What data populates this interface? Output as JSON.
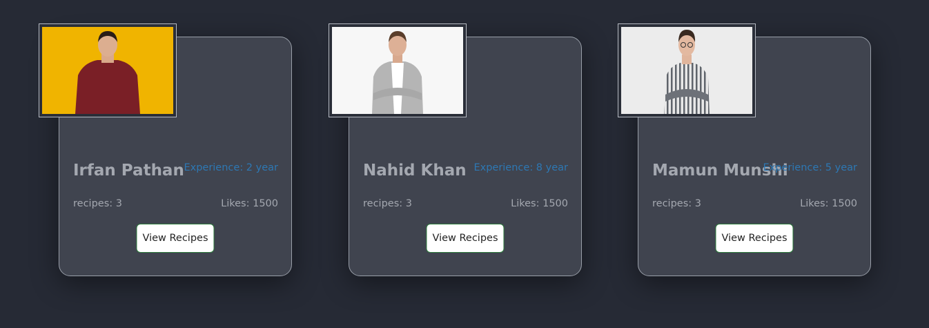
{
  "chefs": [
    {
      "name": "Irfan Pathan",
      "experience": "Experience: 2 year",
      "recipes": "recipes: 3",
      "likes": "Likes: 1500",
      "button_label": "View Recipes",
      "photo_bg": "#f0b400",
      "shirt_color": "#7a1f26"
    },
    {
      "name": "Nahid Khan",
      "experience": "Experience: 8 year",
      "recipes": "recipes: 3",
      "likes": "Likes: 1500",
      "button_label": "View Recipes",
      "photo_bg": "#f7f7f7",
      "shirt_color": "#b5b5b5"
    },
    {
      "name": "Mamun Munshi",
      "experience": "Experience: 5 year",
      "recipes": "recipes: 3",
      "likes": "Likes: 1500",
      "button_label": "View Recipes",
      "photo_bg": "#ececec",
      "shirt_color": "#8a8f96"
    }
  ]
}
